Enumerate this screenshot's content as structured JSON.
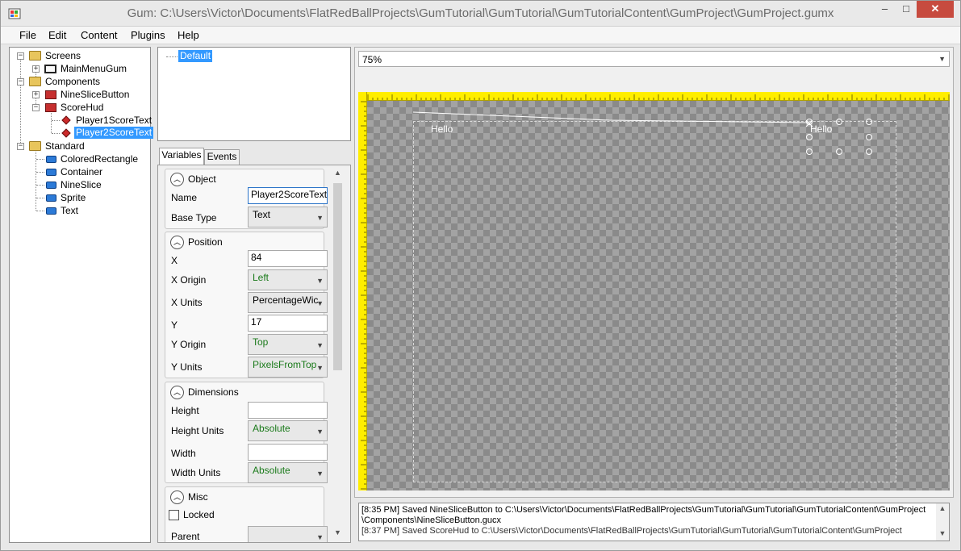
{
  "window": {
    "title": "Gum: C:\\Users\\Victor\\Documents\\FlatRedBallProjects\\GumTutorial\\GumTutorial\\GumTutorialContent\\GumProject\\GumProject.gumx",
    "minimize": "–",
    "maximize": "□",
    "close": "✕"
  },
  "menu": [
    "File",
    "Edit",
    "Content",
    "Plugins",
    "Help"
  ],
  "tree": {
    "screens": "Screens",
    "main_menu": "MainMenuGum",
    "components": "Components",
    "nine_slice_button": "NineSliceButton",
    "score_hud": "ScoreHud",
    "player1": "Player1ScoreText",
    "player2": "Player2ScoreText",
    "standard": "Standard",
    "standard_items": [
      "ColoredRectangle",
      "Container",
      "NineSlice",
      "Sprite",
      "Text"
    ]
  },
  "states": {
    "default": "Default"
  },
  "tabs": {
    "variables": "Variables",
    "events": "Events"
  },
  "properties": {
    "object": {
      "title": "Object",
      "name_label": "Name",
      "name_value": "Player2ScoreText",
      "base_type_label": "Base Type",
      "base_type_value": "Text"
    },
    "position": {
      "title": "Position",
      "x_label": "X",
      "x_value": "84",
      "x_origin_label": "X Origin",
      "x_origin_value": "Left",
      "x_units_label": "X Units",
      "x_units_value": "PercentageWic",
      "y_label": "Y",
      "y_value": "17",
      "y_origin_label": "Y Origin",
      "y_origin_value": "Top",
      "y_units_label": "Y Units",
      "y_units_value": "PixelsFromTop"
    },
    "dimensions": {
      "title": "Dimensions",
      "height_label": "Height",
      "height_value": "",
      "height_units_label": "Height Units",
      "height_units_value": "Absolute",
      "width_label": "Width",
      "width_value": "",
      "width_units_label": "Width Units",
      "width_units_value": "Absolute"
    },
    "misc": {
      "title": "Misc",
      "locked_label": "Locked",
      "parent_label": "Parent"
    }
  },
  "canvas": {
    "zoom": "75%",
    "hello_1": "Hello",
    "hello_2": "Hello"
  },
  "output": {
    "line1": "[8:35 PM] Saved NineSliceButton to C:\\Users\\Victor\\Documents\\FlatRedBallProjects\\GumTutorial\\GumTutorial\\GumTutorialContent\\GumProject",
    "line2": "\\Components\\NineSliceButton.gucx",
    "line3": "[8:37 PM] Saved ScoreHud to C:\\Users\\Victor\\Documents\\FlatRedBallProjects\\GumTutorial\\GumTutorial\\GumTutorialContent\\GumProject"
  },
  "colors": {
    "selection": "#3399ff",
    "ruler": "#ffee00",
    "close_button": "#c74b3f",
    "green_value": "#1a7a1a"
  }
}
